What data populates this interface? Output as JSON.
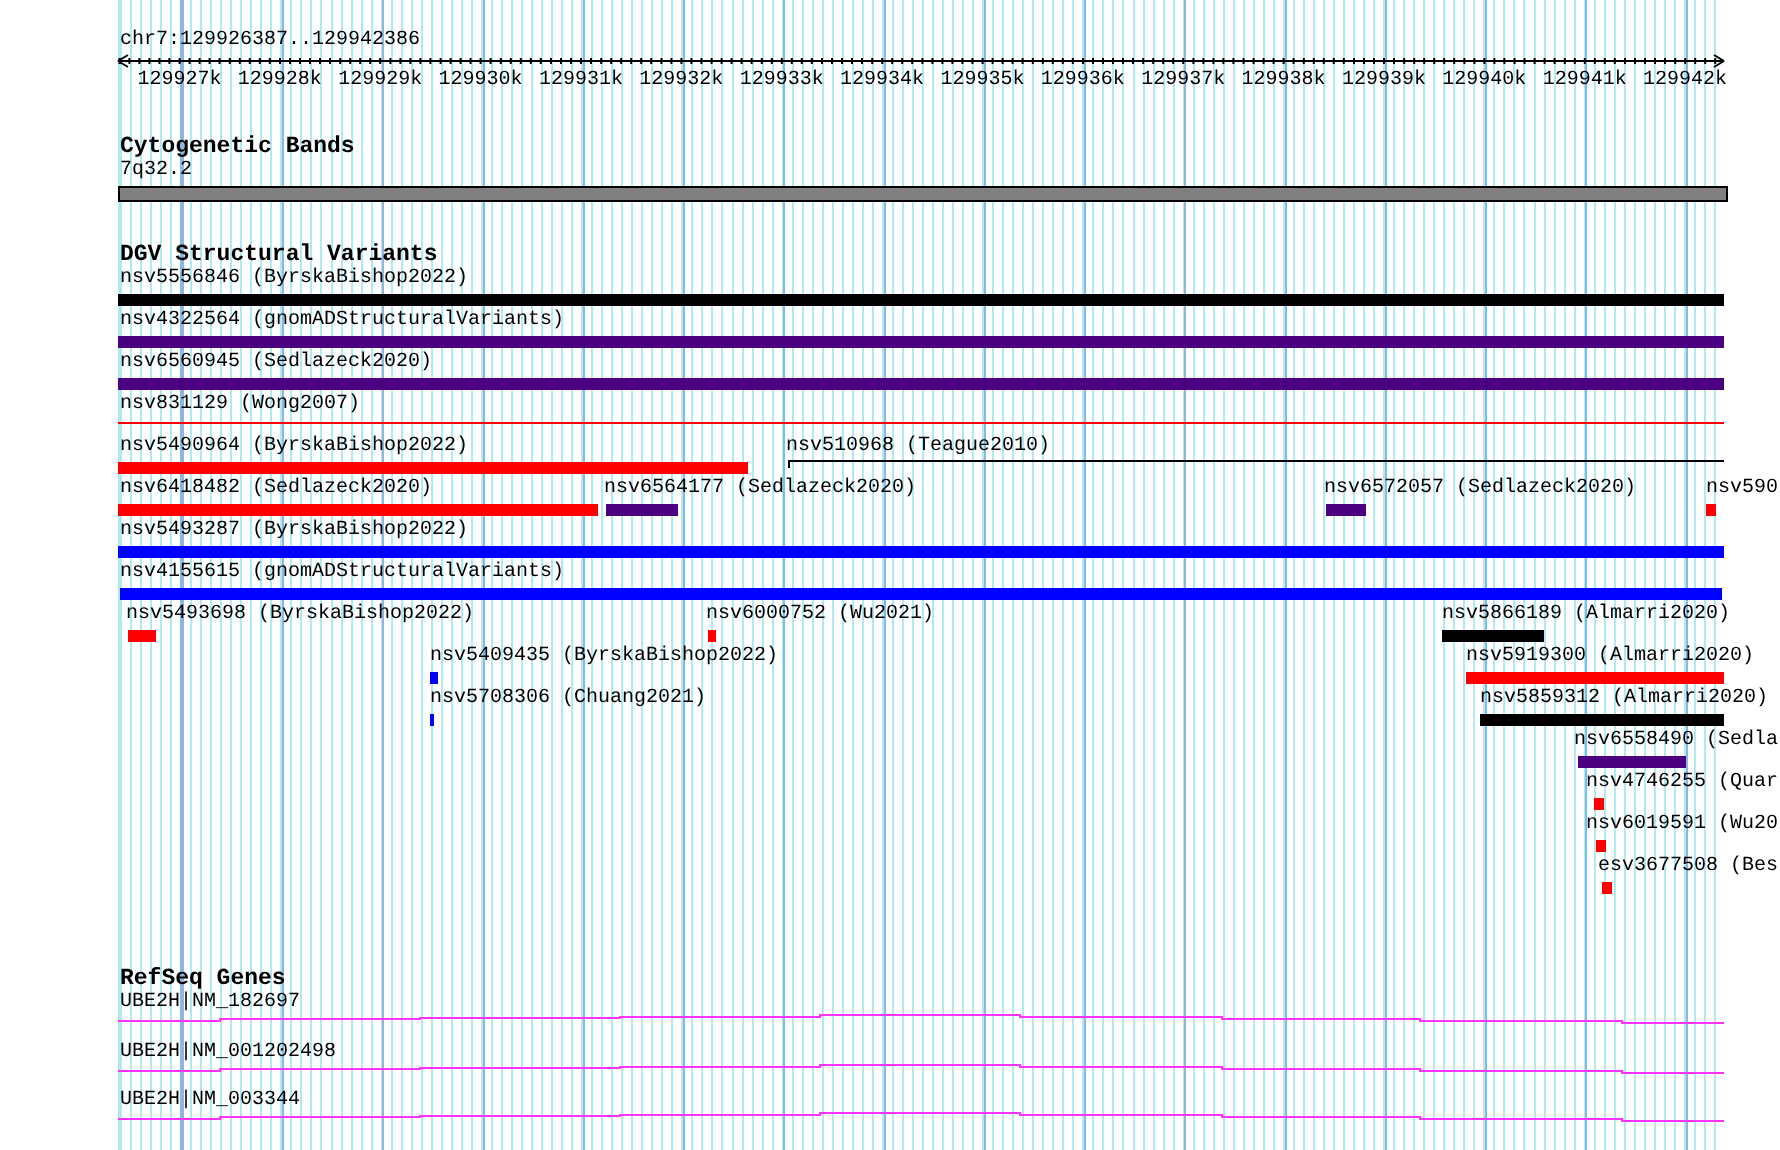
{
  "ruler": {
    "location": "chr7:129926387..129942386",
    "ticks": [
      "129927k",
      "129928k",
      "129929k",
      "129930k",
      "129931k",
      "129932k",
      "129933k",
      "129934k",
      "129935k",
      "129936k",
      "129937k",
      "129938k",
      "129939k",
      "129940k",
      "129941k",
      "129942k"
    ]
  },
  "tracks": [
    {
      "kind": "bands",
      "title": "Cytogenetic Bands",
      "features": [
        {
          "label": "7q32.2",
          "color": "#808080"
        }
      ]
    },
    {
      "kind": "variants",
      "title": "DGV Structural Variants",
      "rows": [
        {
          "features": [
            {
              "label": "nsv5556846 (ByrskaBishop2022)",
              "color": "#000000",
              "kind": "bar"
            }
          ]
        },
        {
          "features": [
            {
              "label": "nsv4322564 (gnomADStructuralVariants)",
              "color": "#4b0082",
              "kind": "bar"
            }
          ]
        },
        {
          "features": [
            {
              "label": "nsv6560945 (Sedlazeck2020)",
              "color": "#4b0082",
              "kind": "bar"
            }
          ]
        },
        {
          "features": [
            {
              "label": "nsv831129 (Wong2007)",
              "color": "#ff0000",
              "kind": "line"
            }
          ]
        },
        {
          "features": [
            {
              "label": "nsv5490964 (ByrskaBishop2022)",
              "color": "#ff0000",
              "kind": "bar"
            },
            {
              "label": "nsv510968 (Teague2010)",
              "color": "#000000",
              "kind": "line"
            }
          ]
        },
        {
          "features": [
            {
              "label": "nsv6418482 (Sedlazeck2020)",
              "color": "#ff0000",
              "kind": "bar"
            },
            {
              "label": "nsv6564177 (Sedlazeck2020)",
              "color": "#4b0082",
              "kind": "bar"
            },
            {
              "label": "nsv6572057 (Sedlazeck2020)",
              "color": "#4b0082",
              "kind": "bar"
            },
            {
              "label": "nsv590",
              "color": "#ff0000",
              "kind": "bar"
            }
          ]
        },
        {
          "features": [
            {
              "label": "nsv5493287 (ByrskaBishop2022)",
              "color": "#0000ff",
              "kind": "bar"
            }
          ]
        },
        {
          "features": [
            {
              "label": "nsv4155615 (gnomADStructuralVariants)",
              "color": "#0000ff",
              "kind": "bar"
            }
          ]
        },
        {
          "features": [
            {
              "label": "nsv5493698 (ByrskaBishop2022)",
              "color": "#ff0000",
              "kind": "bar"
            },
            {
              "label": "nsv6000752 (Wu2021)",
              "color": "#ff0000",
              "kind": "bar"
            },
            {
              "label": "nsv5866189 (Almarri2020)",
              "color": "#000000",
              "kind": "bar"
            }
          ]
        },
        {
          "features": [
            {
              "label": "nsv5409435 (ByrskaBishop2022)",
              "color": "#0000ff",
              "kind": "bar"
            },
            {
              "label": "nsv5919300 (Almarri2020)",
              "color": "#ff0000",
              "kind": "bar"
            }
          ]
        },
        {
          "features": [
            {
              "label": "nsv5708306 (Chuang2021)",
              "color": "#0000ff",
              "kind": "bar"
            },
            {
              "label": "nsv5859312 (Almarri2020)",
              "color": "#000000",
              "kind": "bar"
            }
          ]
        },
        {
          "features": [
            {
              "label": "nsv6558490 (Sedla",
              "color": "#4b0082",
              "kind": "bar"
            }
          ]
        },
        {
          "features": [
            {
              "label": "nsv4746255 (Quar",
              "color": "#ff0000",
              "kind": "bar"
            }
          ]
        },
        {
          "features": [
            {
              "label": "nsv6019591 (Wu20",
              "color": "#ff0000",
              "kind": "bar"
            }
          ]
        },
        {
          "features": [
            {
              "label": "esv3677508 (Bes",
              "color": "#ff0000",
              "kind": "bar"
            }
          ]
        }
      ]
    },
    {
      "kind": "genes",
      "title": "RefSeq Genes",
      "features": [
        {
          "label": "UBE2H|NM_182697"
        },
        {
          "label": "UBE2H|NM_001202498"
        },
        {
          "label": "UBE2H|NM_003344"
        }
      ]
    }
  ]
}
